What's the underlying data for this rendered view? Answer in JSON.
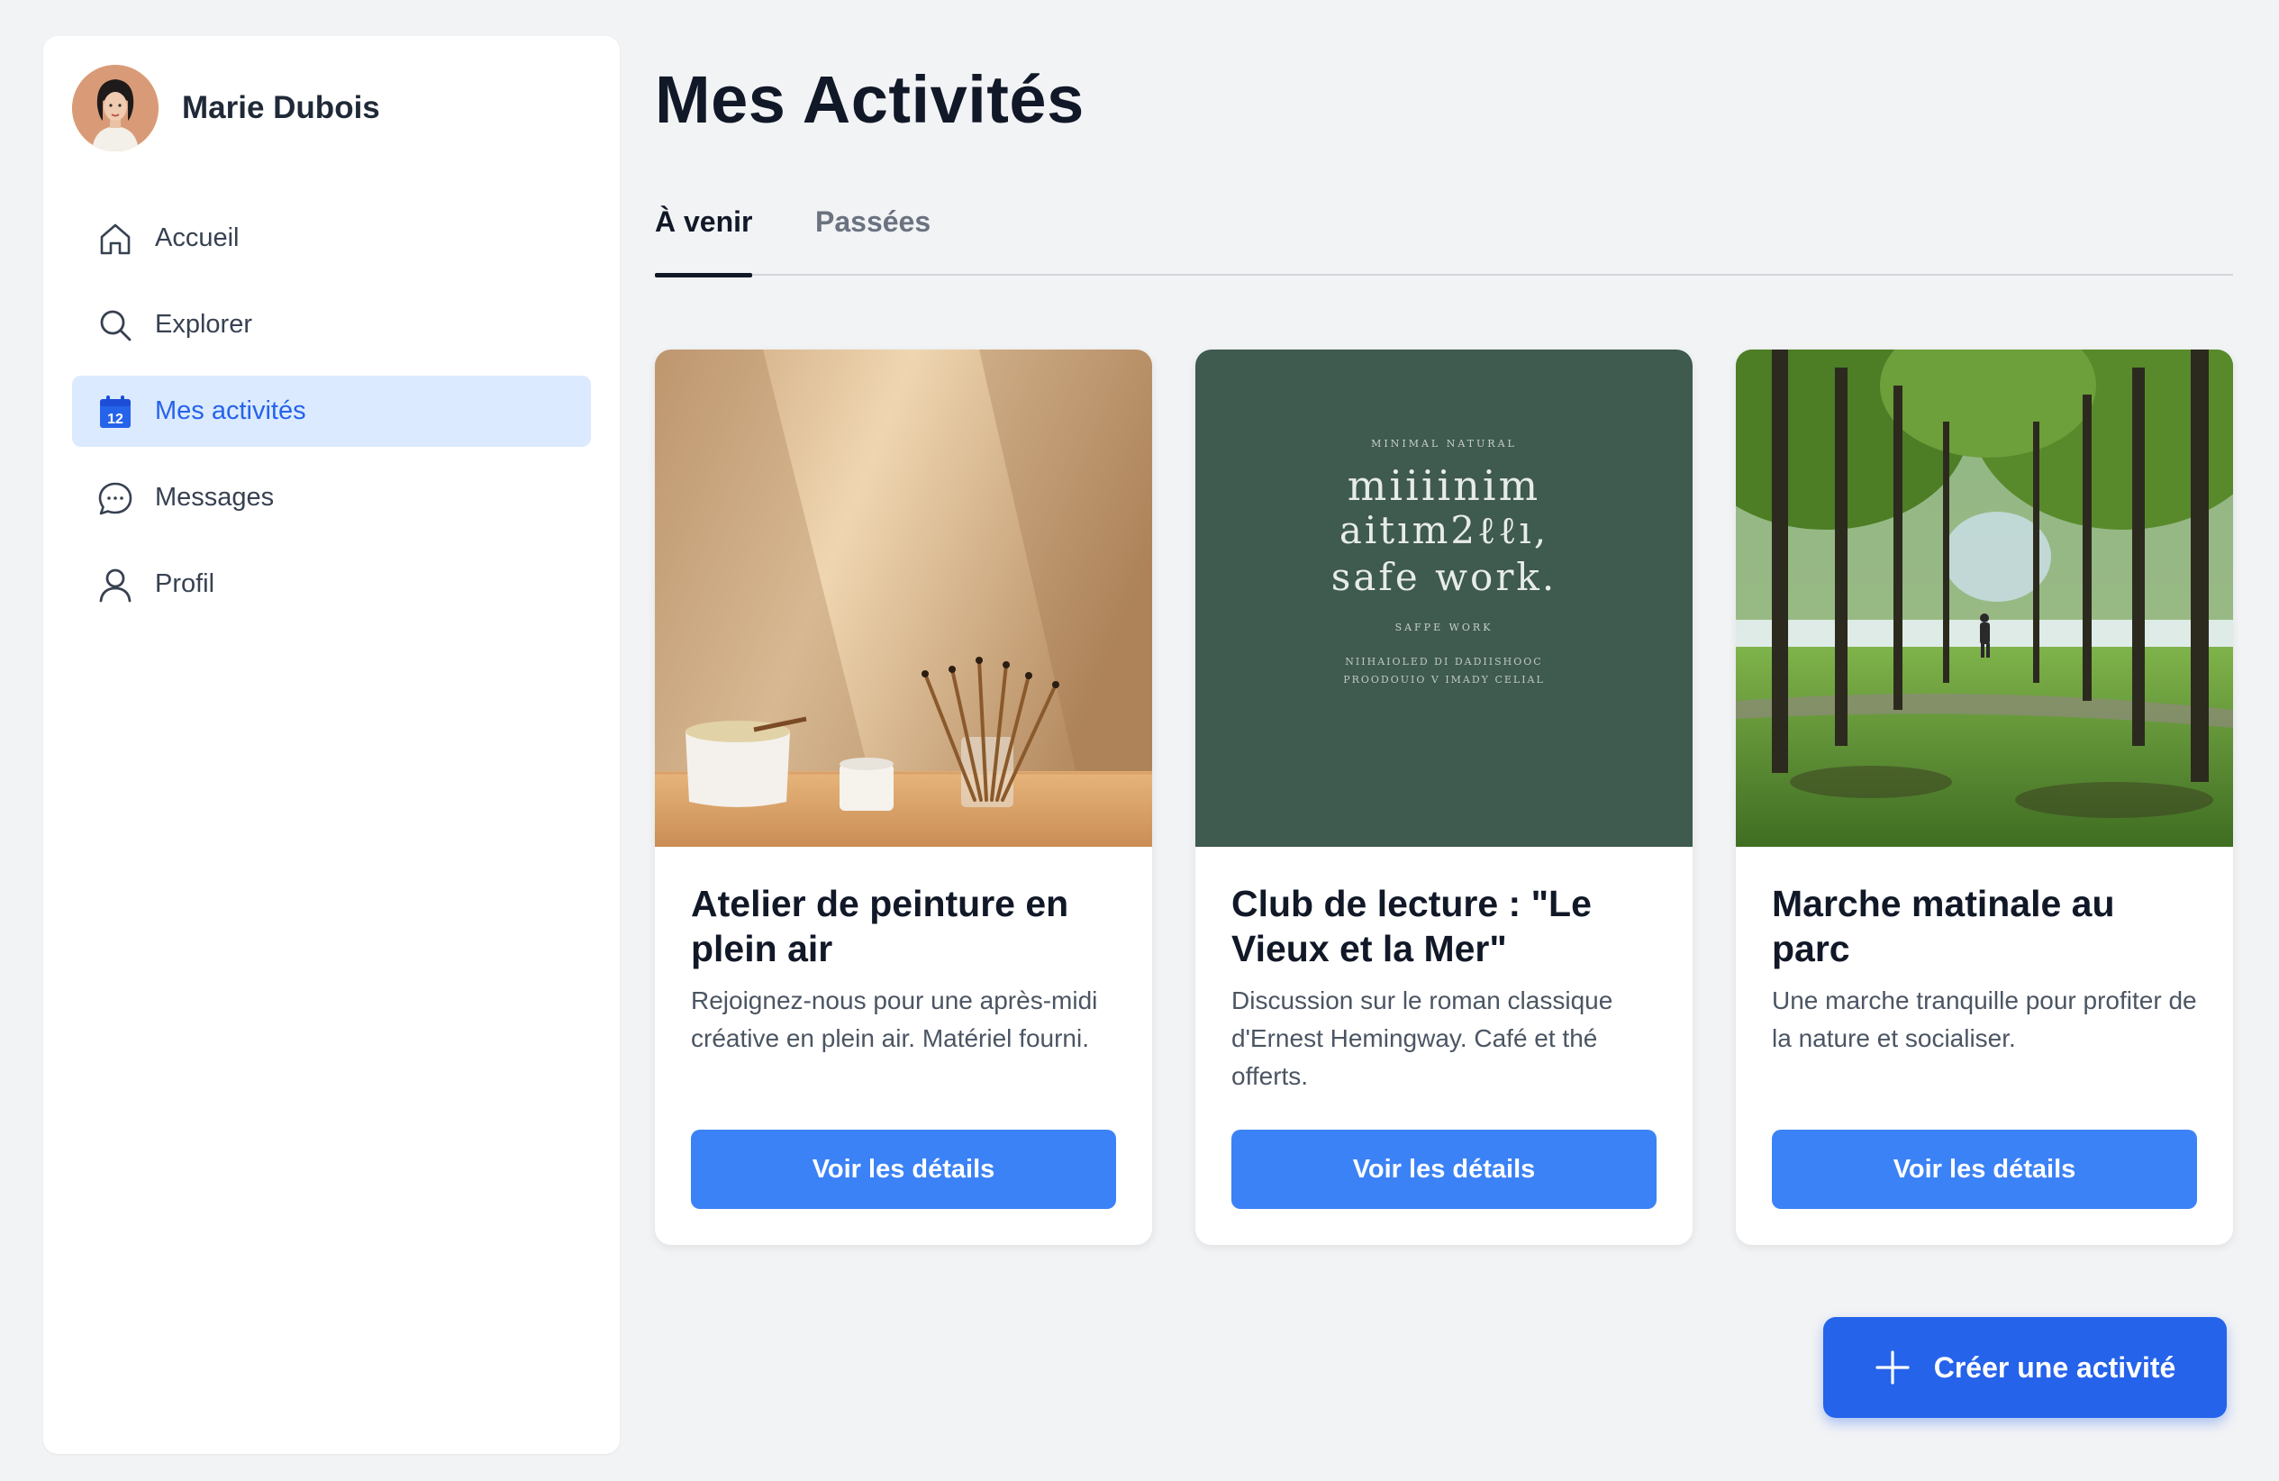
{
  "user": {
    "name": "Marie Dubois",
    "avatar_icon": "avatar-portrait"
  },
  "nav": {
    "items": [
      {
        "label": "Accueil",
        "icon": "home-icon",
        "active": false
      },
      {
        "label": "Explorer",
        "icon": "search-icon",
        "active": false
      },
      {
        "label": "Mes activités",
        "icon": "calendar-icon",
        "active": true,
        "icon_text": "12"
      },
      {
        "label": "Messages",
        "icon": "chat-icon",
        "active": false
      },
      {
        "label": "Profil",
        "icon": "user-icon",
        "active": false
      }
    ]
  },
  "page": {
    "title": "Mes Activités"
  },
  "tabs": [
    {
      "label": "À venir",
      "active": true
    },
    {
      "label": "Passées",
      "active": false
    }
  ],
  "cards": [
    {
      "title": "Atelier de peinture en plein air",
      "description": "Rejoignez-nous pour une après-midi créative en plein air. Matériel fourni.",
      "button": "Voir les détails",
      "image": "painting-supplies-photo"
    },
    {
      "title": "Club de lecture : \"Le Vieux et la Mer\"",
      "description": "Discussion sur le roman classique d'Ernest Hemingway. Café et thé offerts.",
      "button": "Voir les détails",
      "image": "book-cover",
      "cover_text": {
        "top": "MINIMAL NATURAL",
        "line1": "miiiinim",
        "line2": "aitım2ℓℓı,",
        "line3": "safe work.",
        "sub": "SAFPE WORK",
        "small1": "NIIHAIOLED DI DADIISHOOC",
        "small2": "PROODOUIO V IMADY CELIAL"
      }
    },
    {
      "title": "Marche matinale au parc",
      "description": "Une marche tranquille pour profiter de la nature et socialiser.",
      "button": "Voir les détails",
      "image": "park-trees-photo"
    }
  ],
  "fab": {
    "label": "Créer une activité",
    "icon": "plus-icon"
  },
  "colors": {
    "accent": "#3b82f6",
    "accent_dark": "#2563eb",
    "active_bg": "#dbeafe",
    "book_bg": "#3f5a4f"
  }
}
